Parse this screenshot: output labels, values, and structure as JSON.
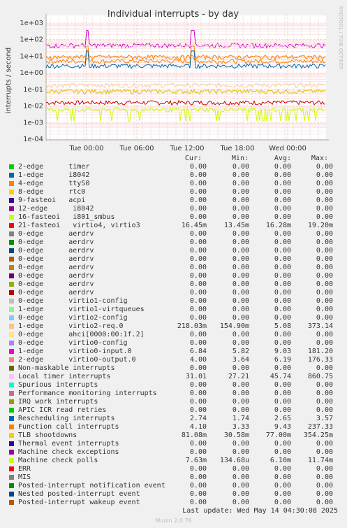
{
  "chart_data": {
    "type": "line",
    "title": "Individual interrupts - by day",
    "ylabel": "interrupts / second",
    "side_label": "RRDTOOL / TOBI OETIKER",
    "y_scale": "log",
    "ylim": [
      0.0001,
      1000
    ],
    "y_ticks": [
      "1e+03",
      "1e+02",
      "1e+01",
      "1e+00",
      "1e-01",
      "1e-02",
      "1e-03",
      "1e-04"
    ],
    "x_ticks": [
      "Tue 00:00",
      "Tue 06:00",
      "Tue 12:00",
      "Tue 18:00",
      "Wed 00:00"
    ],
    "grid": true,
    "series_levels": [
      {
        "color": "#cc0000",
        "level": 0.0162
      },
      {
        "color": "#ff8000",
        "level": 5.08
      },
      {
        "color": "#ffcc99",
        "level": 0.181
      },
      {
        "color": "#00cc00",
        "level": 0.0
      },
      {
        "color": "#0066b3",
        "level": 2.65
      },
      {
        "color": "#e5c100",
        "level": 0.077
      },
      {
        "color": "#cc00cc",
        "level": 45.74
      },
      {
        "color": "#ccff00",
        "level": 0.0061
      },
      {
        "color": "#ffcce5",
        "level": 45.74
      },
      {
        "color": "#ff8000",
        "level": 9.03
      }
    ]
  },
  "legend": {
    "header": {
      "cur": "Cur:",
      "min": "Min:",
      "avg": "Avg:",
      "max": "Max:"
    },
    "rows": [
      {
        "name": "2-edge      timer",
        "color": "#00cc00",
        "cur": "0.00",
        "min": "0.00",
        "avg": "0.00",
        "max": "0.00"
      },
      {
        "name": "1-edge      i8042",
        "color": "#0066b3",
        "cur": "0.00",
        "min": "0.00",
        "avg": "0.00",
        "max": "0.00"
      },
      {
        "name": "4-edge      ttyS0",
        "color": "#ff8000",
        "cur": "0.00",
        "min": "0.00",
        "avg": "0.00",
        "max": "0.00"
      },
      {
        "name": "8-edge      rtc0",
        "color": "#ffcc00",
        "cur": "0.00",
        "min": "0.00",
        "avg": "0.00",
        "max": "0.00"
      },
      {
        "name": "9-fasteoi   acpi",
        "color": "#330099",
        "cur": "0.00",
        "min": "0.00",
        "avg": "0.00",
        "max": "0.00"
      },
      {
        "name": "12-edge      i8042",
        "color": "#990099",
        "cur": "0.00",
        "min": "0.00",
        "avg": "0.00",
        "max": "0.00"
      },
      {
        "name": "16-fasteoi   i801_smbus",
        "color": "#ccff00",
        "cur": "0.00",
        "min": "0.00",
        "avg": "0.00",
        "max": "0.00"
      },
      {
        "name": "21-fasteoi   virtio4, virtio3",
        "color": "#ff0000",
        "cur": "16.45m",
        "min": "13.45m",
        "avg": "16.28m",
        "max": "19.20m"
      },
      {
        "name": "0-edge      aerdrv",
        "color": "#808080",
        "cur": "0.00",
        "min": "0.00",
        "avg": "0.00",
        "max": "0.00"
      },
      {
        "name": "0-edge      aerdrv",
        "color": "#008f00",
        "cur": "0.00",
        "min": "0.00",
        "avg": "0.00",
        "max": "0.00"
      },
      {
        "name": "0-edge      aerdrv",
        "color": "#00487d",
        "cur": "0.00",
        "min": "0.00",
        "avg": "0.00",
        "max": "0.00"
      },
      {
        "name": "0-edge      aerdrv",
        "color": "#b35a00",
        "cur": "0.00",
        "min": "0.00",
        "avg": "0.00",
        "max": "0.00"
      },
      {
        "name": "0-edge      aerdrv",
        "color": "#b38f00",
        "cur": "0.00",
        "min": "0.00",
        "avg": "0.00",
        "max": "0.00"
      },
      {
        "name": "0-edge      aerdrv",
        "color": "#6b006b",
        "cur": "0.00",
        "min": "0.00",
        "avg": "0.00",
        "max": "0.00"
      },
      {
        "name": "0-edge      aerdrv",
        "color": "#8fb300",
        "cur": "0.00",
        "min": "0.00",
        "avg": "0.00",
        "max": "0.00"
      },
      {
        "name": "0-edge      aerdrv",
        "color": "#b30000",
        "cur": "0.00",
        "min": "0.00",
        "avg": "0.00",
        "max": "0.00"
      },
      {
        "name": "0-edge      virtio1-config",
        "color": "#bebebe",
        "cur": "0.00",
        "min": "0.00",
        "avg": "0.00",
        "max": "0.00"
      },
      {
        "name": "1-edge      virtio1-virtqueues",
        "color": "#80ff80",
        "cur": "0.00",
        "min": "0.00",
        "avg": "0.00",
        "max": "0.00"
      },
      {
        "name": "0-edge      virtio2-config",
        "color": "#80c9ff",
        "cur": "0.00",
        "min": "0.00",
        "avg": "0.00",
        "max": "0.00"
      },
      {
        "name": "1-edge      virtio2-req.0",
        "color": "#ffc080",
        "cur": "218.03m",
        "min": "154.90m",
        "avg": "5.08",
        "max": "373.14"
      },
      {
        "name": "0-edge      ahci[0000:00:1f.2]",
        "color": "#ffe680",
        "cur": "0.00",
        "min": "0.00",
        "avg": "0.00",
        "max": "0.00"
      },
      {
        "name": "0-edge      virtio0-config",
        "color": "#aa80ff",
        "cur": "0.00",
        "min": "0.00",
        "avg": "0.00",
        "max": "0.00"
      },
      {
        "name": "1-edge      virtio0-input.0",
        "color": "#ee00cc",
        "cur": "6.84",
        "min": "5.82",
        "avg": "9.03",
        "max": "181.20"
      },
      {
        "name": "2-edge      virtio0-output.0",
        "color": "#ff8080",
        "cur": "4.00",
        "min": "3.64",
        "avg": "6.19",
        "max": "176.33"
      },
      {
        "name": "Non-maskable interrupts",
        "color": "#666600",
        "cur": "0.00",
        "min": "0.00",
        "avg": "0.00",
        "max": "0.00"
      },
      {
        "name": "Local timer interrupts",
        "color": "#ffbfff",
        "cur": "31.01",
        "min": "27.21",
        "avg": "45.74",
        "max": "860.75"
      },
      {
        "name": "Spurious interrupts",
        "color": "#00ffcc",
        "cur": "0.00",
        "min": "0.00",
        "avg": "0.00",
        "max": "0.00"
      },
      {
        "name": "Performance monitoring interrupts",
        "color": "#cc6699",
        "cur": "0.00",
        "min": "0.00",
        "avg": "0.00",
        "max": "0.00"
      },
      {
        "name": "IRQ work interrupts",
        "color": "#999900",
        "cur": "0.00",
        "min": "0.00",
        "avg": "0.00",
        "max": "0.00"
      },
      {
        "name": "APIC ICR read retries",
        "color": "#00cc00",
        "cur": "0.00",
        "min": "0.00",
        "avg": "0.00",
        "max": "0.00"
      },
      {
        "name": "Rescheduling interrupts",
        "color": "#0066b3",
        "cur": "2.74",
        "min": "1.74",
        "avg": "2.65",
        "max": "3.57"
      },
      {
        "name": "Function call interrupts",
        "color": "#ff8000",
        "cur": "4.10",
        "min": "3.33",
        "avg": "9.43",
        "max": "237.33"
      },
      {
        "name": "TLB shootdowns",
        "color": "#ffcc00",
        "cur": "81.08m",
        "min": "30.58m",
        "avg": "77.00m",
        "max": "354.25m"
      },
      {
        "name": "Thermal event interrupts",
        "color": "#330099",
        "cur": "0.00",
        "min": "0.00",
        "avg": "0.00",
        "max": "0.00"
      },
      {
        "name": "Machine check exceptions",
        "color": "#990099",
        "cur": "0.00",
        "min": "0.00",
        "avg": "0.00",
        "max": "0.00"
      },
      {
        "name": "Machine check polls",
        "color": "#ccff00",
        "cur": "7.63m",
        "min": "134.68u",
        "avg": "6.10m",
        "max": "11.74m"
      },
      {
        "name": "ERR",
        "color": "#ff0000",
        "cur": "0.00",
        "min": "0.00",
        "avg": "0.00",
        "max": "0.00"
      },
      {
        "name": "MIS",
        "color": "#808080",
        "cur": "0.00",
        "min": "0.00",
        "avg": "0.00",
        "max": "0.00"
      },
      {
        "name": "Posted-interrupt notification event",
        "color": "#008f00",
        "cur": "0.00",
        "min": "0.00",
        "avg": "0.00",
        "max": "0.00"
      },
      {
        "name": "Nested posted-interrupt event",
        "color": "#00487d",
        "cur": "0.00",
        "min": "0.00",
        "avg": "0.00",
        "max": "0.00"
      },
      {
        "name": "Posted-interrupt wakeup event",
        "color": "#b35a00",
        "cur": "0.00",
        "min": "0.00",
        "avg": "0.00",
        "max": "0.00"
      }
    ]
  },
  "footer": {
    "last_update": "Last update: Wed May 14 04:30:08 2025",
    "generator": "Munin 2.0.76"
  }
}
